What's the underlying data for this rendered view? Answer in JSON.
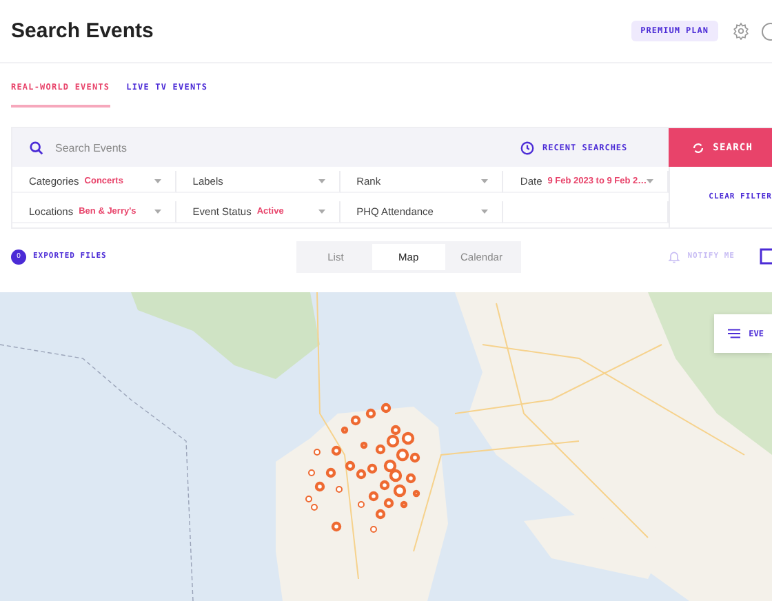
{
  "header": {
    "title": "Search Events",
    "plan_badge": "PREMIUM PLAN"
  },
  "tabs": [
    {
      "label": "REAL-WORLD EVENTS",
      "selected": true
    },
    {
      "label": "LIVE TV EVENTS",
      "selected": false
    }
  ],
  "search": {
    "placeholder": "Search Events",
    "recent_label": "RECENT SEARCHES",
    "button": "SEARCH",
    "clear_button": "CLEAR FILTER"
  },
  "filters": [
    {
      "label": "Categories",
      "value": "Concerts"
    },
    {
      "label": "Labels"
    },
    {
      "label": "Rank"
    },
    {
      "label": "Date",
      "value": "9 Feb 2023 to 9 Feb 2…"
    },
    {
      "label": "Locations",
      "value": "Ben & Jerry's"
    },
    {
      "label": "Event Status",
      "value": "Active"
    },
    {
      "label": "PHQ Attendance"
    }
  ],
  "exports": {
    "count": "0",
    "label": "EXPORTED FILES"
  },
  "views": [
    {
      "label": "List",
      "selected": false
    },
    {
      "label": "Map",
      "selected": true
    },
    {
      "label": "Calendar",
      "selected": false
    }
  ],
  "notify": {
    "label": "NOTIFY ME",
    "disabled": true
  },
  "map": {
    "legend_button": "EVE"
  }
}
